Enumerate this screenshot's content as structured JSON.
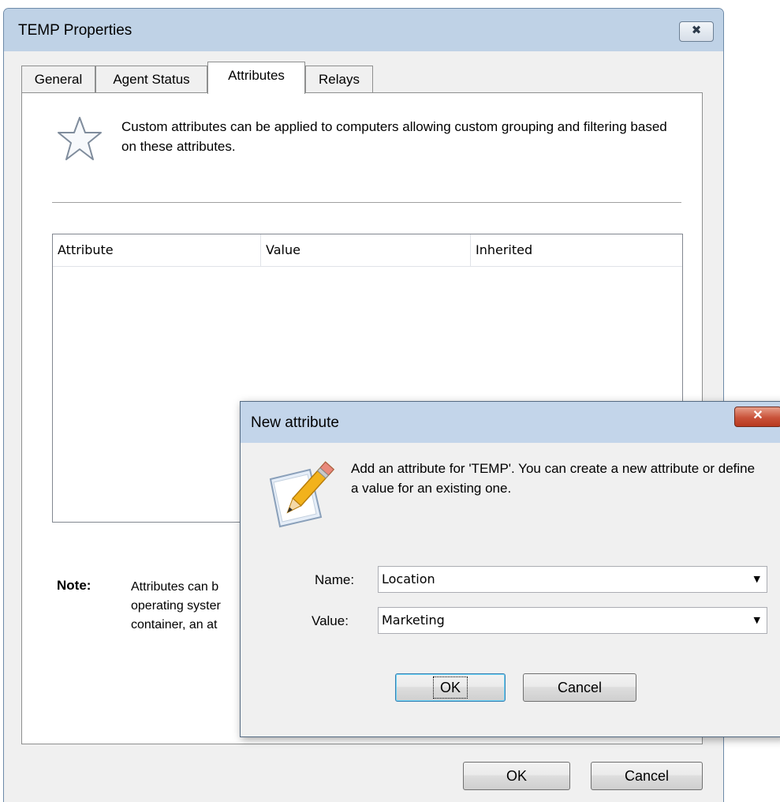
{
  "main_window": {
    "title": "TEMP Properties",
    "close_glyph": "✖",
    "tabs": [
      {
        "label": "General"
      },
      {
        "label": "Agent Status"
      },
      {
        "label": "Attributes"
      },
      {
        "label": "Relays"
      }
    ],
    "active_tab": "Attributes",
    "intro_text": "Custom attributes can be applied to computers allowing custom grouping and filtering based on these attributes.",
    "table": {
      "columns": [
        "Attribute",
        "Value",
        "Inherited"
      ],
      "rows": []
    },
    "note": {
      "label": "Note:",
      "lines": [
        "Attributes can b",
        "operating syster",
        "container, an at"
      ]
    },
    "buttons": {
      "ok": "OK",
      "cancel": "Cancel"
    }
  },
  "dialog": {
    "title": "New attribute",
    "close_glyph": "✕",
    "description": "Add an attribute for 'TEMP'. You can create a new attribute or define a value for an existing one.",
    "name_label": "Name:",
    "name_value": "Location",
    "value_label": "Value:",
    "value_value": "Marketing",
    "dropdown_glyph": "▼",
    "buttons": {
      "ok": "OK",
      "cancel": "Cancel"
    }
  },
  "icons": {
    "star": "star-icon",
    "pencil": "pencil-notepad-icon"
  },
  "colors": {
    "titlebar": "#bfd2e6",
    "dialog_close": "#c9523a",
    "default_button_border": "#3c7fb1"
  }
}
